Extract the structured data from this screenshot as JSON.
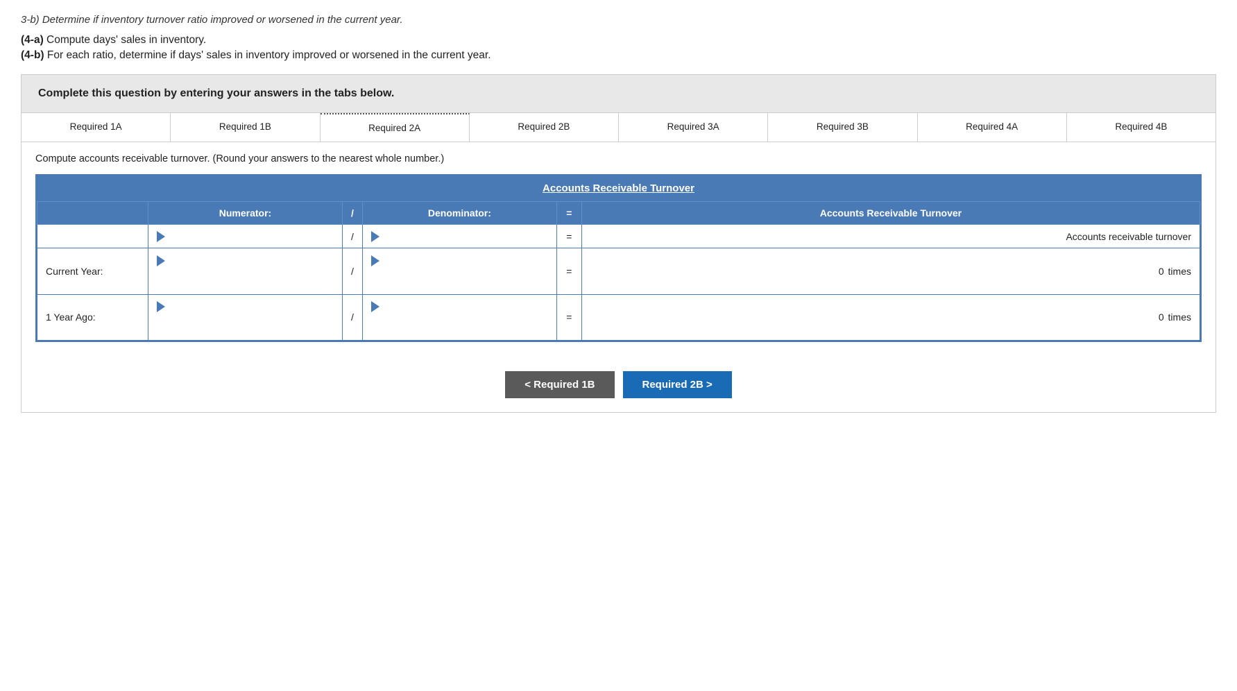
{
  "page": {
    "top_text": "3-b) Determine if inventory turnover ratio improved or worsened in the current year.",
    "instruction_4a": "(4-a) Compute days' sales in inventory.",
    "instruction_4b": "(4-b) For each ratio, determine if days' sales in inventory improved or worsened in the current year.",
    "complete_box_text": "Complete this question by entering your answers in the tabs below."
  },
  "tabs": [
    {
      "id": "req1a",
      "label": "Required 1A",
      "active": false
    },
    {
      "id": "req1b",
      "label": "Required 1B",
      "active": false
    },
    {
      "id": "req2a",
      "label": "Required 2A",
      "active": true
    },
    {
      "id": "req2b",
      "label": "Required 2B",
      "active": false
    },
    {
      "id": "req3a",
      "label": "Required 3A",
      "active": false
    },
    {
      "id": "req3b",
      "label": "Required 3B",
      "active": false
    },
    {
      "id": "req4a",
      "label": "Required 4A",
      "active": false
    },
    {
      "id": "req4b",
      "label": "Required 4B",
      "active": false
    }
  ],
  "content": {
    "description": "Compute accounts receivable turnover. (Round your answers to the nearest whole number.)",
    "table_title": "Accounts Receivable Turnover",
    "header": {
      "col_label": "",
      "numerator": "Numerator:",
      "slash": "/",
      "denominator": "Denominator:",
      "equals": "=",
      "result": "Accounts Receivable Turnover"
    },
    "rows": [
      {
        "id": "header-desc",
        "label": "",
        "numerator_value": "",
        "denominator_value": "",
        "result_label": "Accounts receivable turnover",
        "result_value": "",
        "unit": ""
      },
      {
        "id": "current-year",
        "label": "Current Year:",
        "numerator_value": "",
        "denominator_value": "",
        "result_label": "",
        "result_value": "0",
        "unit": "times"
      },
      {
        "id": "one-year-ago",
        "label": "1 Year Ago:",
        "numerator_value": "",
        "denominator_value": "",
        "result_label": "",
        "result_value": "0",
        "unit": "times"
      }
    ]
  },
  "buttons": {
    "prev_label": "< Required 1B",
    "next_label": "Required 2B >"
  }
}
